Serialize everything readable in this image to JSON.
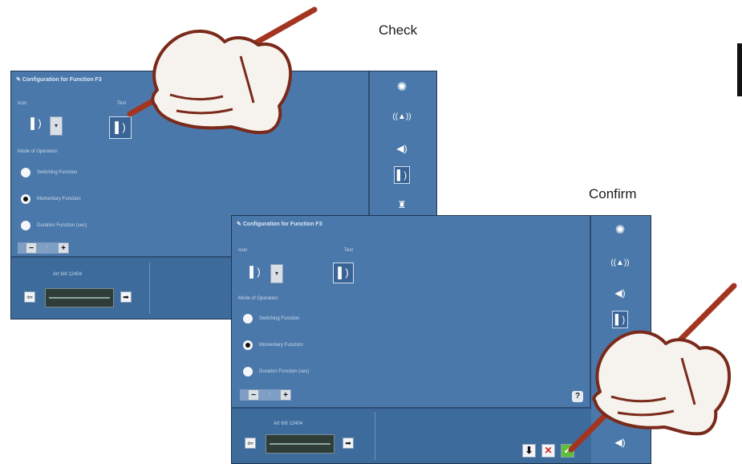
{
  "captions": {
    "check": "Check",
    "confirm": "Confirm"
  },
  "panel_back": {
    "title": "Configuration for Function F3",
    "icon_label": "Icon",
    "test_label": "Test",
    "mode_heading": "Mode of Operation",
    "options": [
      {
        "label": "Switching Function",
        "selected": false
      },
      {
        "label": "Momentary Function",
        "selected": true
      },
      {
        "label": "Duration Function (sec)",
        "selected": false
      }
    ],
    "stepper": {
      "minus": "−",
      "value": "7",
      "plus": "+"
    },
    "loco_label": "Art 6/8 12404",
    "sidebar_icons": [
      "light-icon",
      "horn-icon",
      "sound-icon",
      "function-icon",
      "coupler-icon"
    ]
  },
  "panel_front": {
    "title": "Configuration for Function F3",
    "icon_label": "Icon",
    "test_label": "Test",
    "mode_heading": "Mode of Operation",
    "options": [
      {
        "label": "Switching Function",
        "selected": false
      },
      {
        "label": "Momentary Function",
        "selected": true
      },
      {
        "label": "Duration Function (sec)",
        "selected": false
      }
    ],
    "stepper": {
      "minus": "−",
      "value": "7",
      "plus": "+"
    },
    "help": "?",
    "loco_label": "Art 6/8 12404",
    "actions": {
      "save": "⬇",
      "cancel": "✕",
      "confirm": "✓"
    },
    "sidebar_icons": [
      "light-icon",
      "horn-icon",
      "sound-icon",
      "function-icon",
      "sound-icon"
    ]
  },
  "glyphs": {
    "light": "✺",
    "horn": "((▲))",
    "sound": "◀)",
    "function": "▌)",
    "coupler": "♜",
    "wrench": "✎",
    "back": "⇦",
    "forward": "➡",
    "caret": "▾"
  },
  "colors": {
    "screen": "#4a78aa",
    "pen": "#a33520",
    "hand_outline": "#7a2a1a"
  }
}
